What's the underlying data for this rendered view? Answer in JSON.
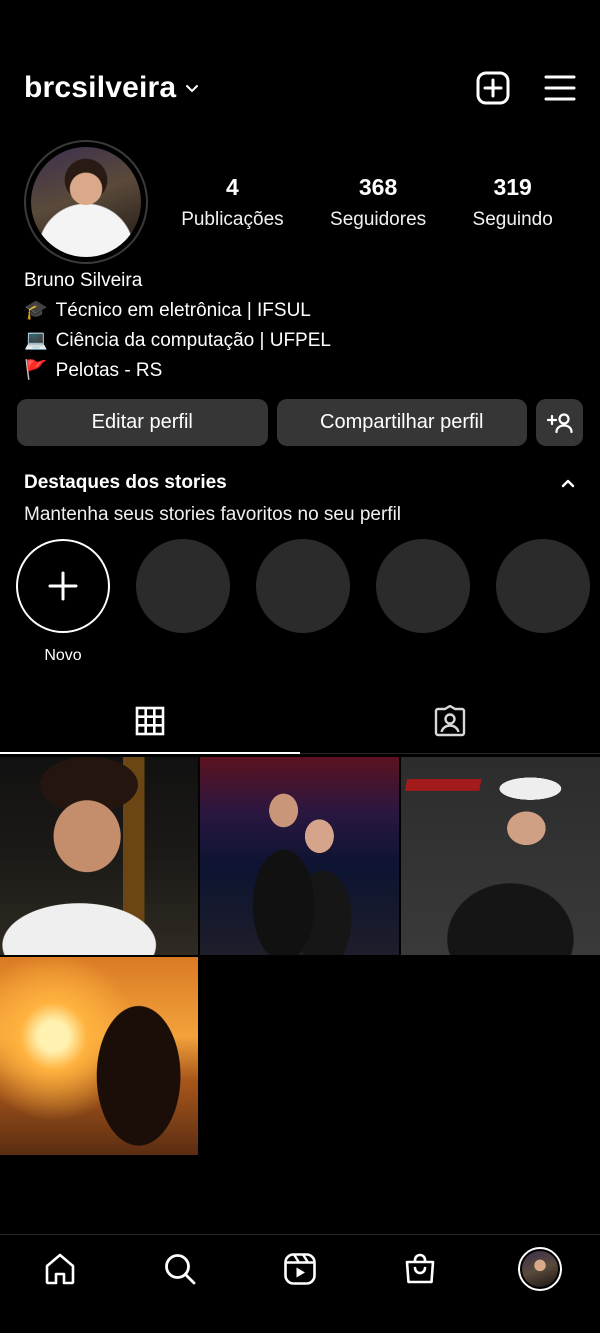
{
  "header": {
    "username": "brcsilveira"
  },
  "stats": [
    {
      "value": "4",
      "label": "Publicações"
    },
    {
      "value": "368",
      "label": "Seguidores"
    },
    {
      "value": "319",
      "label": "Seguindo"
    }
  ],
  "bio": {
    "name": "Bruno Silveira",
    "lines": [
      {
        "emoji": "🎓",
        "text": "Técnico em eletrônica | IFSUL"
      },
      {
        "emoji": "💻",
        "text": "Ciência da computação | UFPEL"
      },
      {
        "emoji": "🚩",
        "text": "Pelotas - RS"
      }
    ]
  },
  "buttons": {
    "edit_profile": "Editar perfil",
    "share_profile": "Compartilhar perfil"
  },
  "highlights": {
    "title": "Destaques dos stories",
    "subtitle": "Mantenha seus stories favoritos no seu perfil",
    "new_label": "Novo"
  },
  "tabs": [
    "grid-icon",
    "tagged-icon"
  ],
  "posts": [
    {
      "id": "post-1"
    },
    {
      "id": "post-2"
    },
    {
      "id": "post-3"
    },
    {
      "id": "post-4"
    }
  ],
  "nav": [
    "home-icon",
    "search-icon",
    "reels-icon",
    "shop-icon",
    "profile-avatar"
  ]
}
